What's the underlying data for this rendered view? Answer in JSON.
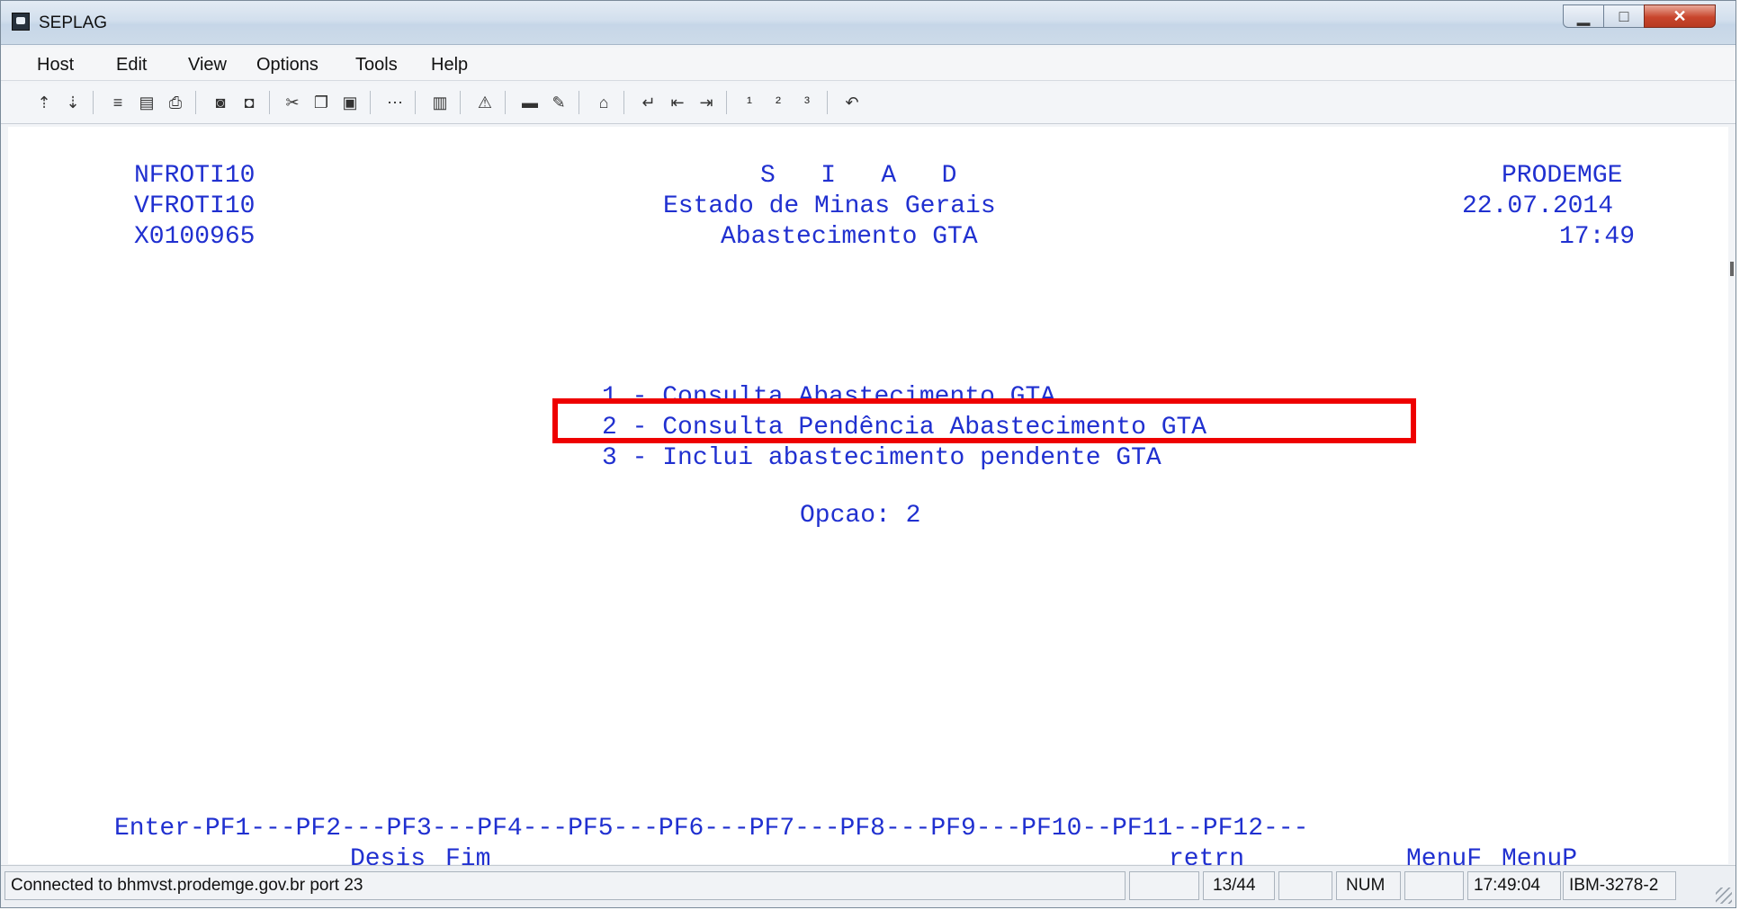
{
  "window": {
    "title": "SEPLAG"
  },
  "menu": [
    "Host",
    "Edit",
    "View",
    "Options",
    "Tools",
    "Help"
  ],
  "toolbar_icons": [
    "send-file-icon",
    "receive-file-icon",
    "macro-icon",
    "transfer-icon",
    "print-icon",
    "copy-screen-icon",
    "paste-screen-icon",
    "cut-icon",
    "copy-icon",
    "paste-icon",
    "more-icon",
    "graph-icon",
    "warning-icon",
    "terminal-icon",
    "edit-icon",
    "home-icon",
    "enter-icon",
    "reset-icon",
    "tab-icon",
    "pa1-icon",
    "pa2-icon",
    "pa3-icon",
    "undo-icon"
  ],
  "terminal": {
    "header_left": [
      "NFROTI10",
      "VFROTI10",
      "X0100965"
    ],
    "header_center": [
      "S   I   A   D",
      "Estado de Minas Gerais",
      "Abastecimento GTA"
    ],
    "header_right": [
      "PRODEMGE",
      "22.07.2014",
      "17:49"
    ],
    "options": [
      "1 - Consulta Abastecimento GTA",
      "2 - Consulta Pendência Abastecimento GTA",
      "3 - Inclui abastecimento pendente GTA"
    ],
    "prompt": "Opcao: 2",
    "pf_line": "Enter-PF1---PF2---PF3---PF4---PF5---PF6---PF7---PF8---PF9---PF10--PF11--PF12---",
    "pf_labels": {
      "pf2": "Desis",
      "pf3": "Fim",
      "pf9": "retrn",
      "pf11": "MenuF",
      "pf12": "MenuP"
    }
  },
  "status": {
    "connection": "Connected to bhmvst.prodemge.gov.br port 23",
    "cursor": "13/44",
    "num": "NUM",
    "time": "17:49:04",
    "terminal_type": "IBM-3278-2"
  },
  "colors": {
    "terminal_text": "#2030d0",
    "highlight": "#ee0000"
  }
}
